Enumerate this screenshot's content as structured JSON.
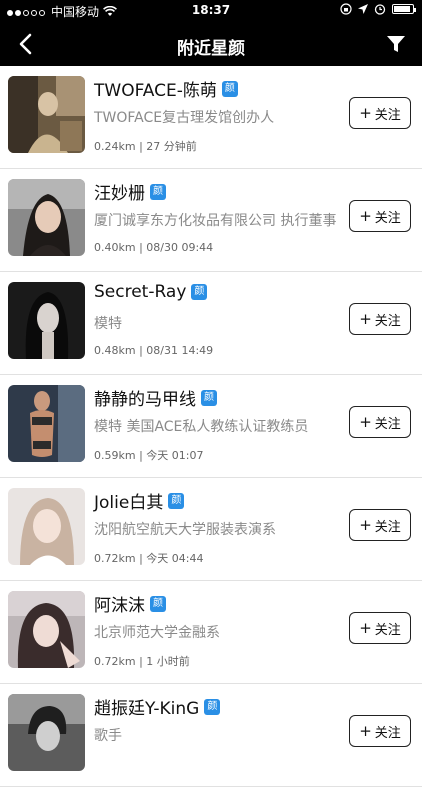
{
  "statusbar": {
    "carrier": "中国移动",
    "time": "18:37"
  },
  "navbar": {
    "title": "附近星颜"
  },
  "badge_text": "颜",
  "follow_label": "关注",
  "follow_plus": "+",
  "items": [
    {
      "name": "TWOFACE-陈萌",
      "desc": "TWOFACE复古理发馆创办人",
      "meta": "0.24km | 27 分钟前"
    },
    {
      "name": "汪妙栅",
      "desc": "厦门诚享东方化妆品有限公司 执行董事",
      "meta": "0.40km | 08/30 09:44"
    },
    {
      "name": "Secret-Ray",
      "desc": "模特",
      "meta": "0.48km | 08/31 14:49"
    },
    {
      "name": "静静的马甲线",
      "desc": "模特 美国ACE私人教练认证教练员",
      "meta": "0.59km | 今天 01:07"
    },
    {
      "name": "Jolie白其",
      "desc": "沈阳航空航天大学服装表演系",
      "meta": "0.72km | 今天 04:44"
    },
    {
      "name": "阿沫沫",
      "desc": "北京师范大学金融系",
      "meta": "0.72km | 1 小时前"
    },
    {
      "name": "趙振廷Y-KinG",
      "desc": "歌手",
      "meta": ""
    }
  ]
}
